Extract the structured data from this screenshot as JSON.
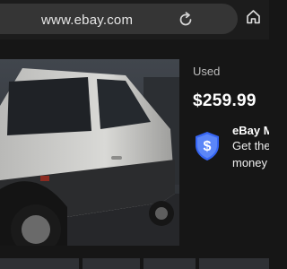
{
  "browser": {
    "url": "www.ebay.com",
    "icons": [
      "lock-icon",
      "reload-icon",
      "home-icon"
    ]
  },
  "listing": {
    "condition": "Used",
    "price": "$259.99"
  },
  "promo": {
    "icon": "shield-dollar-icon",
    "title": "eBay M",
    "line1": "Get the",
    "line2": "money"
  },
  "colors": {
    "accent": "#3665f3",
    "background": "#161616"
  }
}
